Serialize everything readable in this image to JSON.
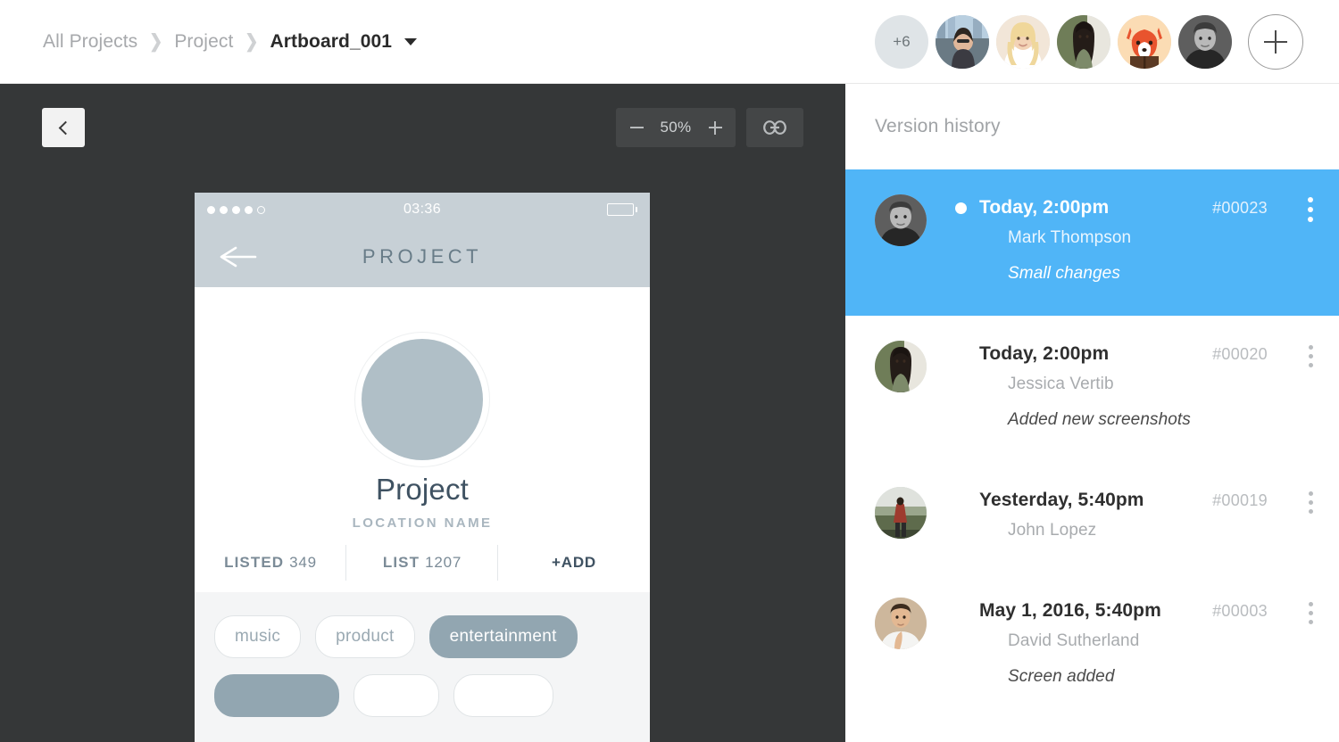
{
  "breadcrumb": {
    "items": [
      "All Projects",
      "Project"
    ],
    "current": "Artboard_001",
    "separator": "❯"
  },
  "collaborators": {
    "overflow_label": "+6",
    "add_label": "+",
    "avatars": [
      {
        "name": "avatar-woman-city"
      },
      {
        "name": "avatar-blonde-woman"
      },
      {
        "name": "avatar-dark-hair-woman"
      },
      {
        "name": "avatar-fox-illustration"
      },
      {
        "name": "avatar-man-bw"
      }
    ]
  },
  "canvas_toolbar": {
    "back_icon": "chevron-left-icon",
    "zoom_out_label": "−",
    "zoom_value": "50%",
    "zoom_in_label": "+",
    "link_icon": "link-icon"
  },
  "mockup": {
    "status_bar": {
      "time": "03:36",
      "signal_dots_total": 5,
      "signal_dots_filled": 4,
      "battery_icon": "battery-full-icon"
    },
    "nav": {
      "back_icon": "arrow-left-icon",
      "title": "PROJECT"
    },
    "project": {
      "name": "Project",
      "location": "LOCATION NAME"
    },
    "stats": [
      {
        "label": "LISTED",
        "value": "349"
      },
      {
        "label": "LIST",
        "value": "1207"
      }
    ],
    "add_label": "+ADD",
    "tags": [
      {
        "label": "music",
        "selected": false
      },
      {
        "label": "product",
        "selected": false
      },
      {
        "label": "entertainment",
        "selected": true
      }
    ],
    "tags_row2": [
      {
        "label": "",
        "selected": true
      },
      {
        "label": "",
        "selected": false
      },
      {
        "label": "",
        "selected": false
      }
    ]
  },
  "panel": {
    "title": "Version history",
    "accent_color": "#50b5f7",
    "versions": [
      {
        "date": "Today, 2:00pm",
        "author": "Mark Thompson",
        "note": "Small changes",
        "id": "#00023",
        "selected": true,
        "avatar": "avatar-man-bw"
      },
      {
        "date": "Today, 2:00pm",
        "author": "Jessica Vertib",
        "note": "Added new screenshots",
        "id": "#00020",
        "selected": false,
        "avatar": "avatar-dark-hair-woman"
      },
      {
        "date": "Yesterday, 5:40pm",
        "author": "John Lopez",
        "note": "",
        "id": "#00019",
        "selected": false,
        "avatar": "avatar-field-walker"
      },
      {
        "date": "May 1, 2016, 5:40pm",
        "author": "David Sutherland",
        "note": "Screen added",
        "id": "#00003",
        "selected": false,
        "avatar": "avatar-man-white-shirt"
      }
    ]
  }
}
